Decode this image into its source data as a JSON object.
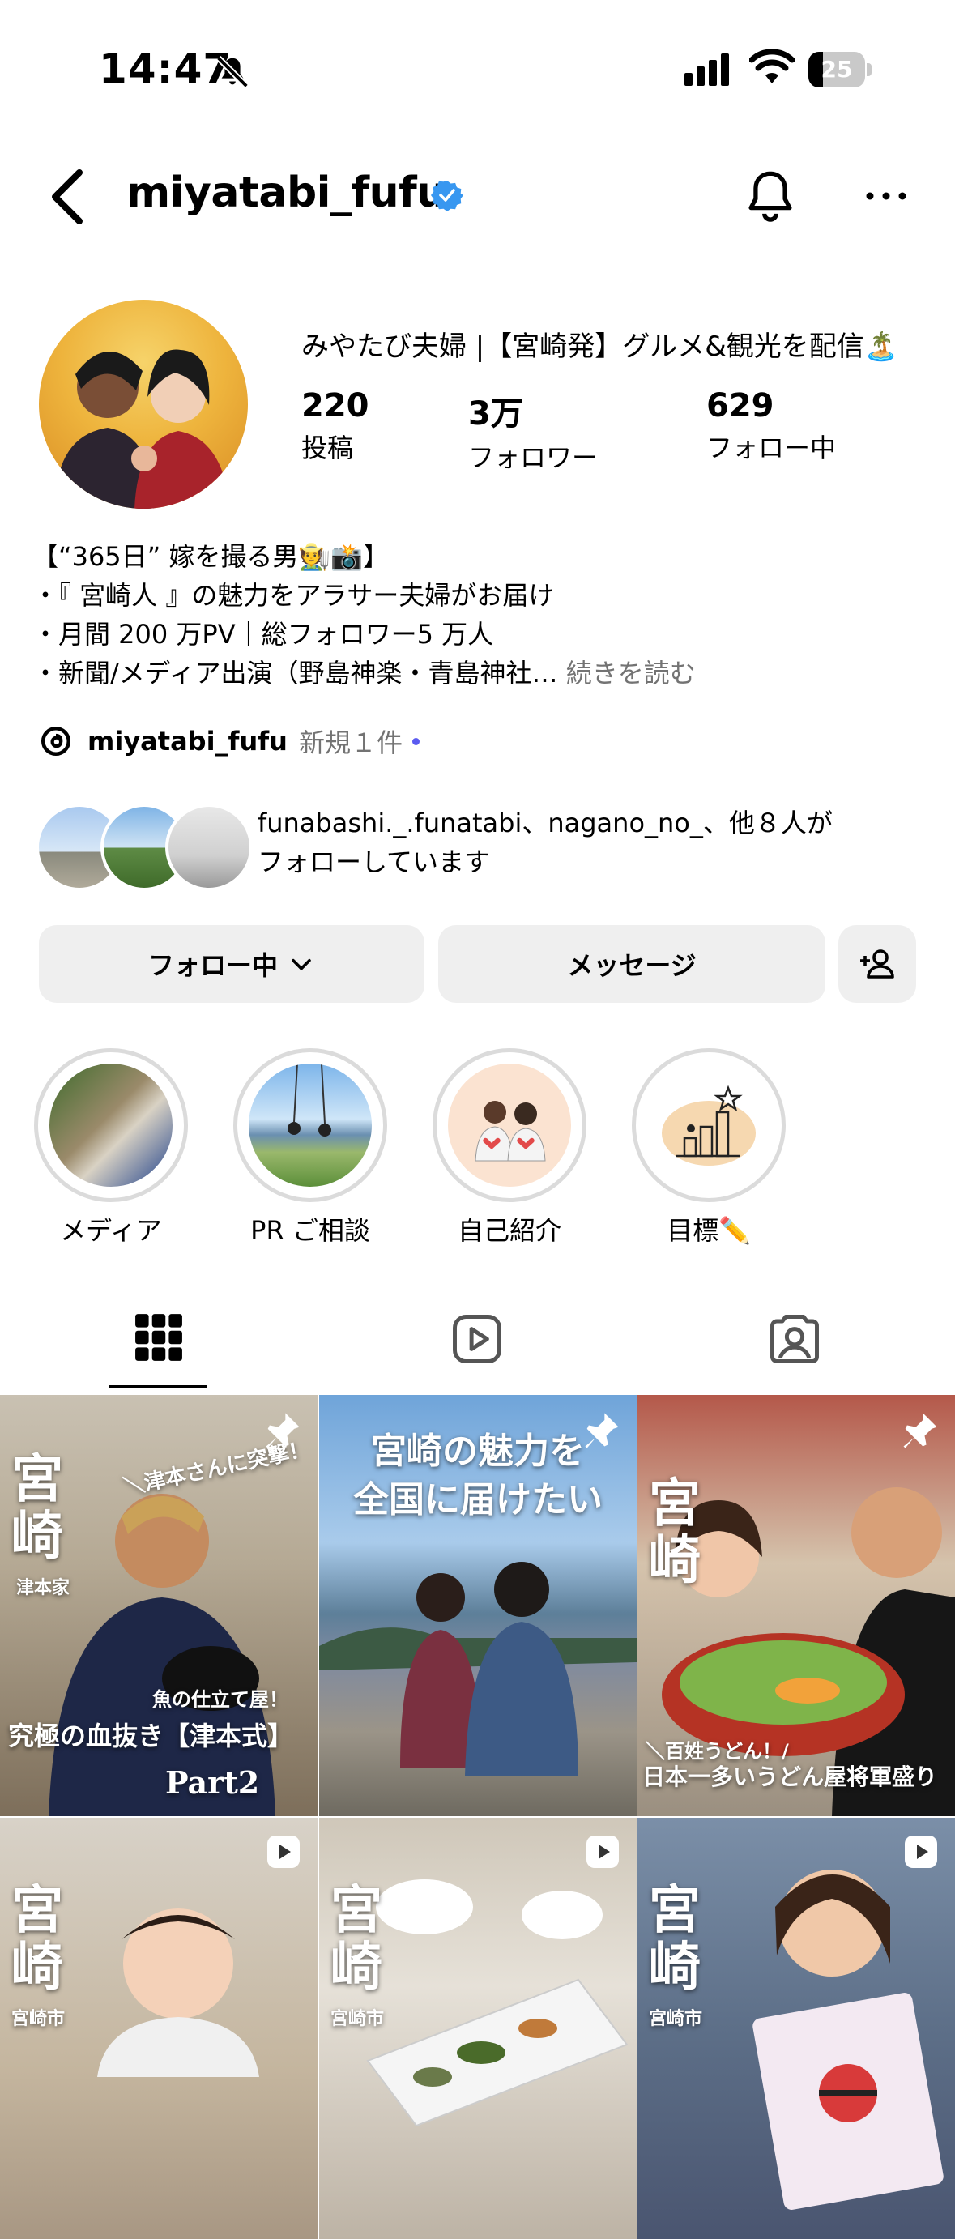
{
  "status_bar": {
    "time": "14:47",
    "battery": "25",
    "battery_level": 0.25
  },
  "header": {
    "username": "miyatabi_fufu"
  },
  "profile": {
    "display_name": "みやたび夫婦 |【宮崎発】グルメ&観光を配信🏝️",
    "stats": [
      {
        "value": "220",
        "label": "投稿"
      },
      {
        "value": "3万",
        "label": "フォロワー"
      },
      {
        "value": "629",
        "label": "フォロー中"
      }
    ],
    "bio": [
      "【“365日” 嫁を撮る男🧑‍🌾📸】",
      "・『 宮崎人 』の魅力をアラサー夫婦がお届け",
      "・月間 200 万PV｜総フォロワー5 万人",
      "・新聞/メディア出演（野島神楽・青島神社…"
    ],
    "bio_more": "続きを読む",
    "threads": {
      "name": "miyatabi_fufu",
      "new": "新規１件"
    },
    "mutual": [
      "funabashi._.funatabi、nagano_no_、他８人が",
      "フォローしています"
    ]
  },
  "buttons": {
    "following": "フォロー中",
    "message": "メッセージ"
  },
  "highlights": [
    {
      "label": "メディア"
    },
    {
      "label": "PR ご相談"
    },
    {
      "label": "自己紹介"
    },
    {
      "label": "目標✏️"
    }
  ],
  "tiles": [
    {
      "big": "宮\n崎",
      "sub": "津本家",
      "top": "＼津本さんに突撃！",
      "caption": "魚の仕立て屋！",
      "title": "究極の血抜き【津本式】",
      "extra": "Part2",
      "badge": "pin"
    },
    {
      "big": "",
      "sub": "",
      "top": "宮崎の魅力を\n全国に届けたい",
      "caption": "",
      "title": "",
      "extra": "",
      "badge": "pin"
    },
    {
      "big": "宮\n崎",
      "sub": "",
      "top": "",
      "caption": "＼百姓うどん！/",
      "title": "日本一多いうどん屋将軍盛り",
      "extra": "",
      "badge": "pin"
    },
    {
      "big": "宮\n崎",
      "sub": "宮崎市",
      "top": "",
      "caption": "",
      "title": "",
      "extra": "",
      "badge": "reel"
    },
    {
      "big": "宮\n崎",
      "sub": "宮崎市",
      "top": "",
      "caption": "",
      "title": "",
      "extra": "",
      "badge": "reel"
    },
    {
      "big": "宮\n崎",
      "sub": "宮崎市",
      "top": "",
      "caption": "",
      "title": "",
      "extra": "",
      "badge": "reel"
    }
  ],
  "colors": {
    "verified": "#3897f0",
    "link": "#737373",
    "button_bg": "#efefef"
  }
}
